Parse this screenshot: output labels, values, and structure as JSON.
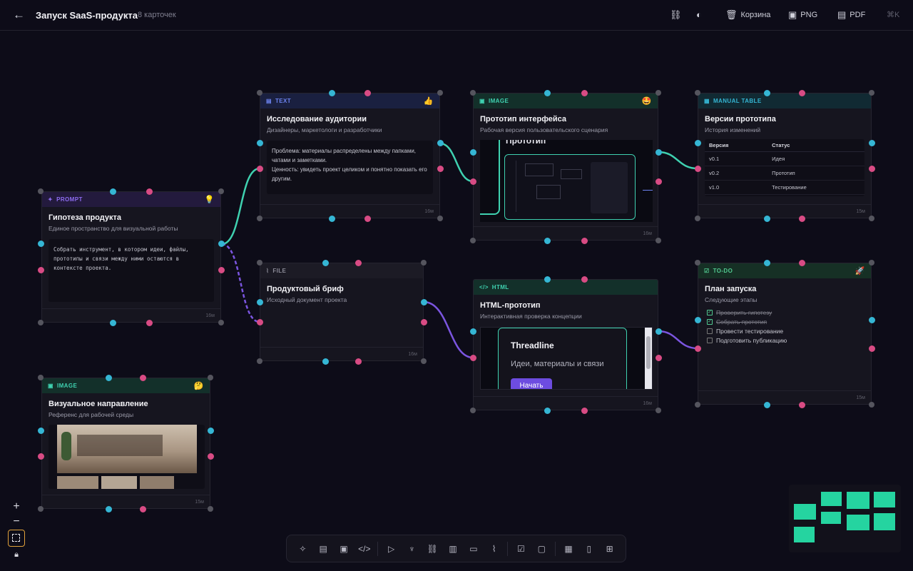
{
  "header": {
    "title": "Запуск SaaS-продукта",
    "card_count": "8 карточек",
    "tools": {
      "trash": "Корзина",
      "png": "PNG",
      "pdf": "PDF",
      "shortcut": "⌘K"
    }
  },
  "cards": {
    "prompt": {
      "type": "PROMPT",
      "emoji": "💡",
      "title": "Гипотеза продукта",
      "subtitle": "Единое пространство для визуальной работы",
      "body": "Собрать инструмент, в котором идеи, файлы, прототипы и связи между ними остаются в контексте проекта.",
      "time": "16м"
    },
    "text": {
      "type": "TEXT",
      "emoji": "👍",
      "title": "Исследование аудитории",
      "subtitle": "Дизайнеры, маркетологи и разработчики",
      "body1": "Проблема: материалы распределены между папками, чатами и заметками.",
      "body2": "Ценность: увидеть проект целиком и понятно показать его другим.",
      "time": "16м"
    },
    "image1": {
      "type": "IMAGE",
      "emoji": "🤩",
      "title": "Прототип интерфейса",
      "subtitle": "Рабочая версия пользовательского сценария",
      "preview_label": "Прототип",
      "time": "16м"
    },
    "table": {
      "type": "MANUAL TABLE",
      "title": "Версии прототипа",
      "subtitle": "История изменений",
      "columns": [
        "Версия",
        "Статус"
      ],
      "rows": [
        [
          "v0.1",
          "Идея"
        ],
        [
          "v0.2",
          "Прототип"
        ],
        [
          "v1.0",
          "Тестирование"
        ]
      ],
      "time": "15м"
    },
    "file": {
      "type": "FILE",
      "title": "Продуктовый бриф",
      "subtitle": "Исходный документ проекта",
      "time": "16м"
    },
    "html": {
      "type": "HTML",
      "title": "HTML-прототип",
      "subtitle": "Интерактивная проверка концепции",
      "preview_title": "Threadline",
      "preview_sub": "Идеи, материалы и связи",
      "preview_button": "Начать",
      "time": "16м"
    },
    "todo": {
      "type": "TO-DO",
      "emoji": "🚀",
      "title": "План запуска",
      "subtitle": "Следующие этапы",
      "items": [
        {
          "label": "Проверить гипотезу",
          "done": true
        },
        {
          "label": "Собрать прототип",
          "done": true
        },
        {
          "label": "Провести тестирование",
          "done": false
        },
        {
          "label": "Подготовить публикацию",
          "done": false
        }
      ],
      "time": "15м"
    },
    "image2": {
      "type": "IMAGE",
      "emoji": "🤔",
      "title": "Визуальное направление",
      "subtitle": "Референс для рабочей среды",
      "time": "15м"
    }
  },
  "colors": {
    "accent_cyan": "#35b6d4",
    "accent_pink": "#d84b84",
    "link_green": "#3fd1b0",
    "link_purple": "#7b55e0",
    "minimap": "#25d4a0"
  }
}
